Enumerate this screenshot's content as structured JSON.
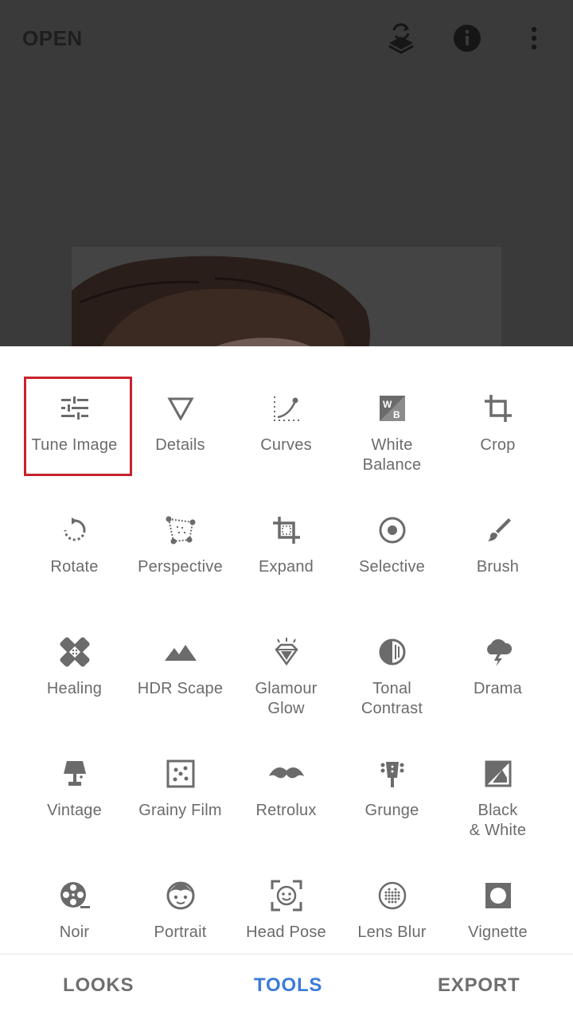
{
  "header": {
    "open_label": "OPEN",
    "icons": [
      "layers-undo-icon",
      "info-icon",
      "more-vert-icon"
    ]
  },
  "tools": [
    {
      "label": "Tune Image",
      "icon": "tune-icon"
    },
    {
      "label": "Details",
      "icon": "details-triangle-icon"
    },
    {
      "label": "Curves",
      "icon": "curves-icon"
    },
    {
      "label": "White\nBalance",
      "icon": "white-balance-icon"
    },
    {
      "label": "Crop",
      "icon": "crop-icon"
    },
    {
      "label": "Rotate",
      "icon": "rotate-icon"
    },
    {
      "label": "Perspective",
      "icon": "perspective-icon"
    },
    {
      "label": "Expand",
      "icon": "expand-icon"
    },
    {
      "label": "Selective",
      "icon": "selective-icon"
    },
    {
      "label": "Brush",
      "icon": "brush-icon"
    },
    {
      "label": "Healing",
      "icon": "healing-icon"
    },
    {
      "label": "HDR Scape",
      "icon": "hdr-mountains-icon"
    },
    {
      "label": "Glamour\nGlow",
      "icon": "glamour-diamond-icon"
    },
    {
      "label": "Tonal\nContrast",
      "icon": "tonal-contrast-icon"
    },
    {
      "label": "Drama",
      "icon": "drama-cloud-icon"
    },
    {
      "label": "Vintage",
      "icon": "vintage-lamp-icon"
    },
    {
      "label": "Grainy Film",
      "icon": "grainy-film-icon"
    },
    {
      "label": "Retrolux",
      "icon": "mustache-icon"
    },
    {
      "label": "Grunge",
      "icon": "guitar-icon"
    },
    {
      "label": "Black\n& White",
      "icon": "black-white-icon"
    },
    {
      "label": "Noir",
      "icon": "film-reel-icon"
    },
    {
      "label": "Portrait",
      "icon": "face-icon"
    },
    {
      "label": "Head Pose",
      "icon": "head-pose-icon"
    },
    {
      "label": "Lens Blur",
      "icon": "lens-blur-icon"
    },
    {
      "label": "Vignette",
      "icon": "vignette-icon"
    }
  ],
  "highlighted_tool": "Tune Image",
  "bottom_nav": {
    "looks": "LOOKS",
    "tools": "TOOLS",
    "export": "EXPORT",
    "active": "TOOLS"
  },
  "colors": {
    "icon_gray": "#6b6b6b",
    "active_tab": "#3b7bd8",
    "highlight_border": "#c8232c",
    "backdrop": "#3a3a3a"
  }
}
